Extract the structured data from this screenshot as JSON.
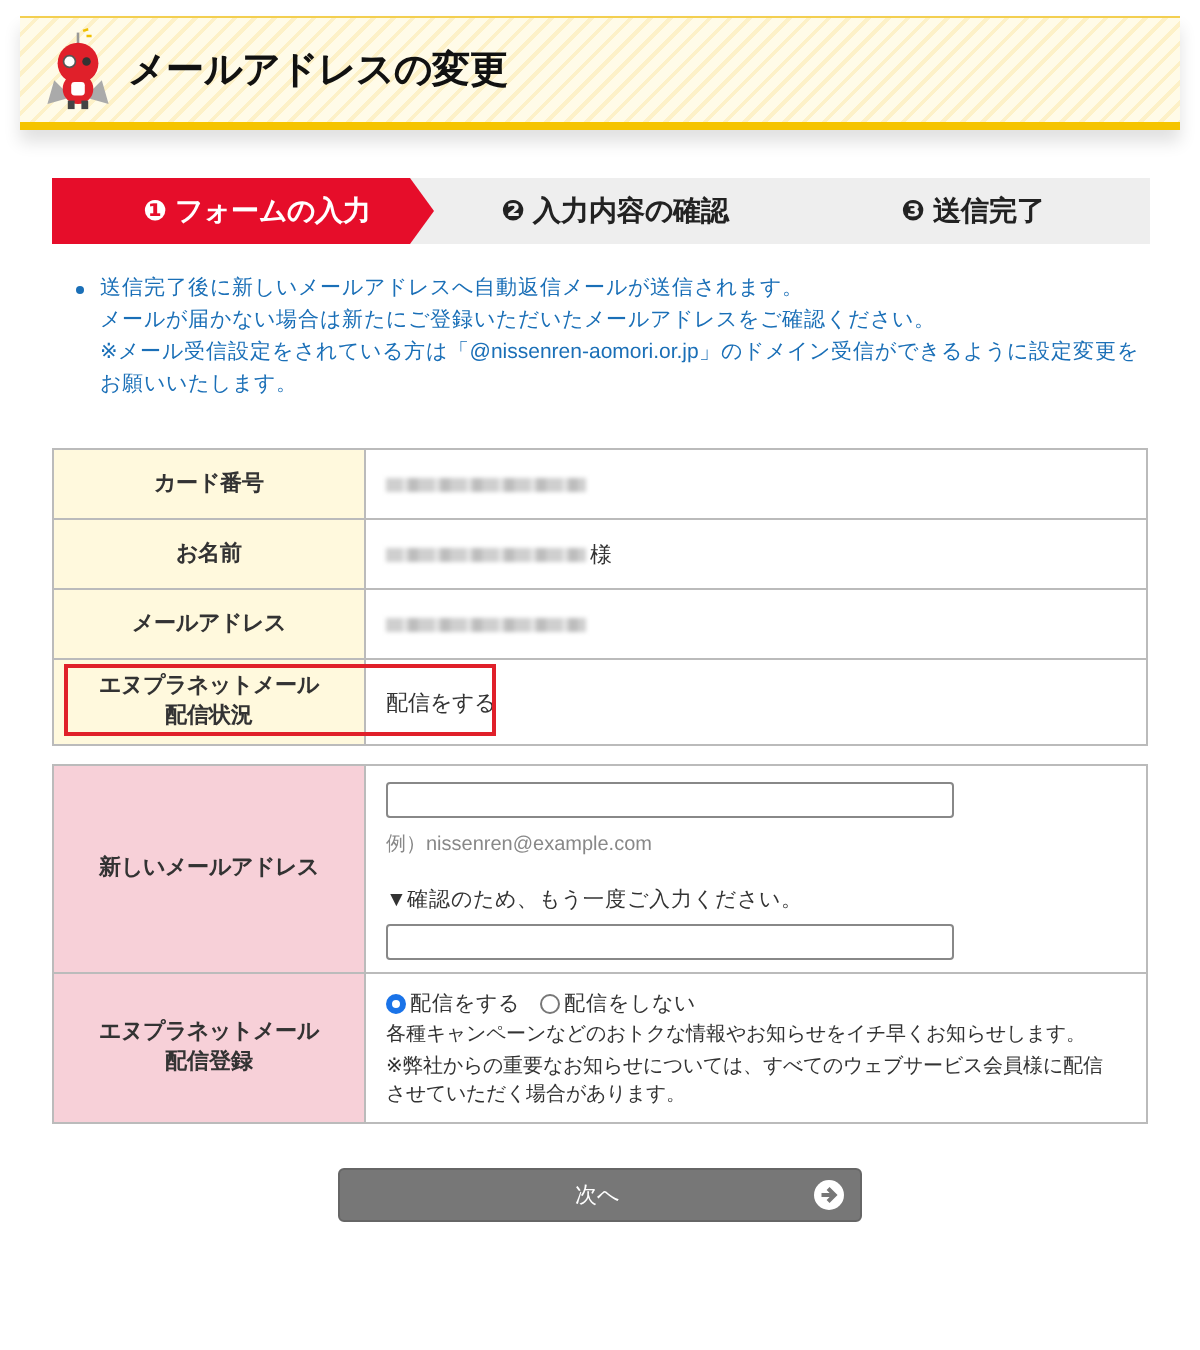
{
  "header": {
    "title": "メールアドレスの変更"
  },
  "steps": [
    {
      "label": "❶ フォームの入力",
      "selected": true
    },
    {
      "label": "❷ 入力内容の確認",
      "selected": false
    },
    {
      "label": "❸ 送信完了",
      "selected": false
    }
  ],
  "notes": [
    "送信完了後に新しいメールアドレスへ自動返信メールが送信されます。",
    "メールが届かない場合は新たにご登録いただいたメールアドレスをご確認ください。",
    "※メール受信設定をされている方は「@nissenren-aomori.or.jp」のドメイン受信ができるように設定変更をお願いいたします。"
  ],
  "info_rows": [
    {
      "label": "カード番号",
      "kind": "redacted",
      "highlighted": false
    },
    {
      "label": "お名前",
      "kind": "redacted",
      "suffix": "様",
      "highlighted": false
    },
    {
      "label": "メールアドレス",
      "kind": "redacted",
      "highlighted": false
    },
    {
      "label": "エヌプラネットメール配信状況",
      "kind": "text",
      "value": "配信をする",
      "highlighted": true
    }
  ],
  "form": {
    "new_email": {
      "label": "新しいメールアドレス",
      "hint": "例）nissenren@example.com",
      "confirm_label": "▼確認のため、もう一度ご入力ください。"
    },
    "subscription": {
      "label": "エヌプラネットメール配信登録",
      "options": [
        {
          "label": "配信をする",
          "selected": true
        },
        {
          "label": "配信をしない",
          "selected": false
        }
      ],
      "description": [
        "各種キャンペーンなどのおトクな情報やお知らせをイチ早くお知らせします。",
        "※弊社からの重要なお知らせについては、すべてのウェブサービス会員様に配信させていただく場合があります。"
      ]
    }
  },
  "next_button": {
    "label": "次へ"
  }
}
